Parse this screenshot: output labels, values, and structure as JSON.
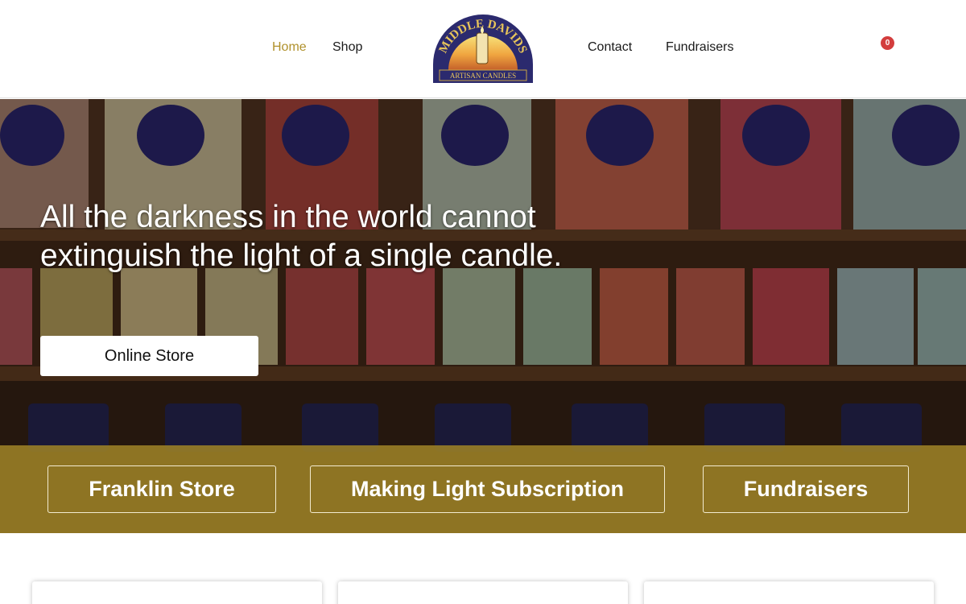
{
  "nav": {
    "items": [
      {
        "label": "Home",
        "active": true
      },
      {
        "label": "Shop",
        "active": false
      },
      {
        "label": "Contact",
        "active": false
      },
      {
        "label": "Fundraisers",
        "active": false
      }
    ],
    "cart_count": "0",
    "logo": {
      "name": "MIDDLE DAVIDS",
      "tagline": "ARTISAN CANDLES",
      "icon": "candle-hand-icon"
    }
  },
  "hero": {
    "quote": "All the darkness in the world cannot extinguish the light of a single candle.",
    "button_label": "Online Store",
    "background": "candle-shelf-photo"
  },
  "band": {
    "buttons": [
      {
        "label": "Franklin Store"
      },
      {
        "label": "Making Light Subscription"
      },
      {
        "label": "Fundraisers"
      }
    ]
  },
  "colors": {
    "accent_gold": "#b0912c",
    "band_gold": "#a08426",
    "badge_red": "#d33d3d",
    "logo_navy": "#2b2a6e"
  }
}
